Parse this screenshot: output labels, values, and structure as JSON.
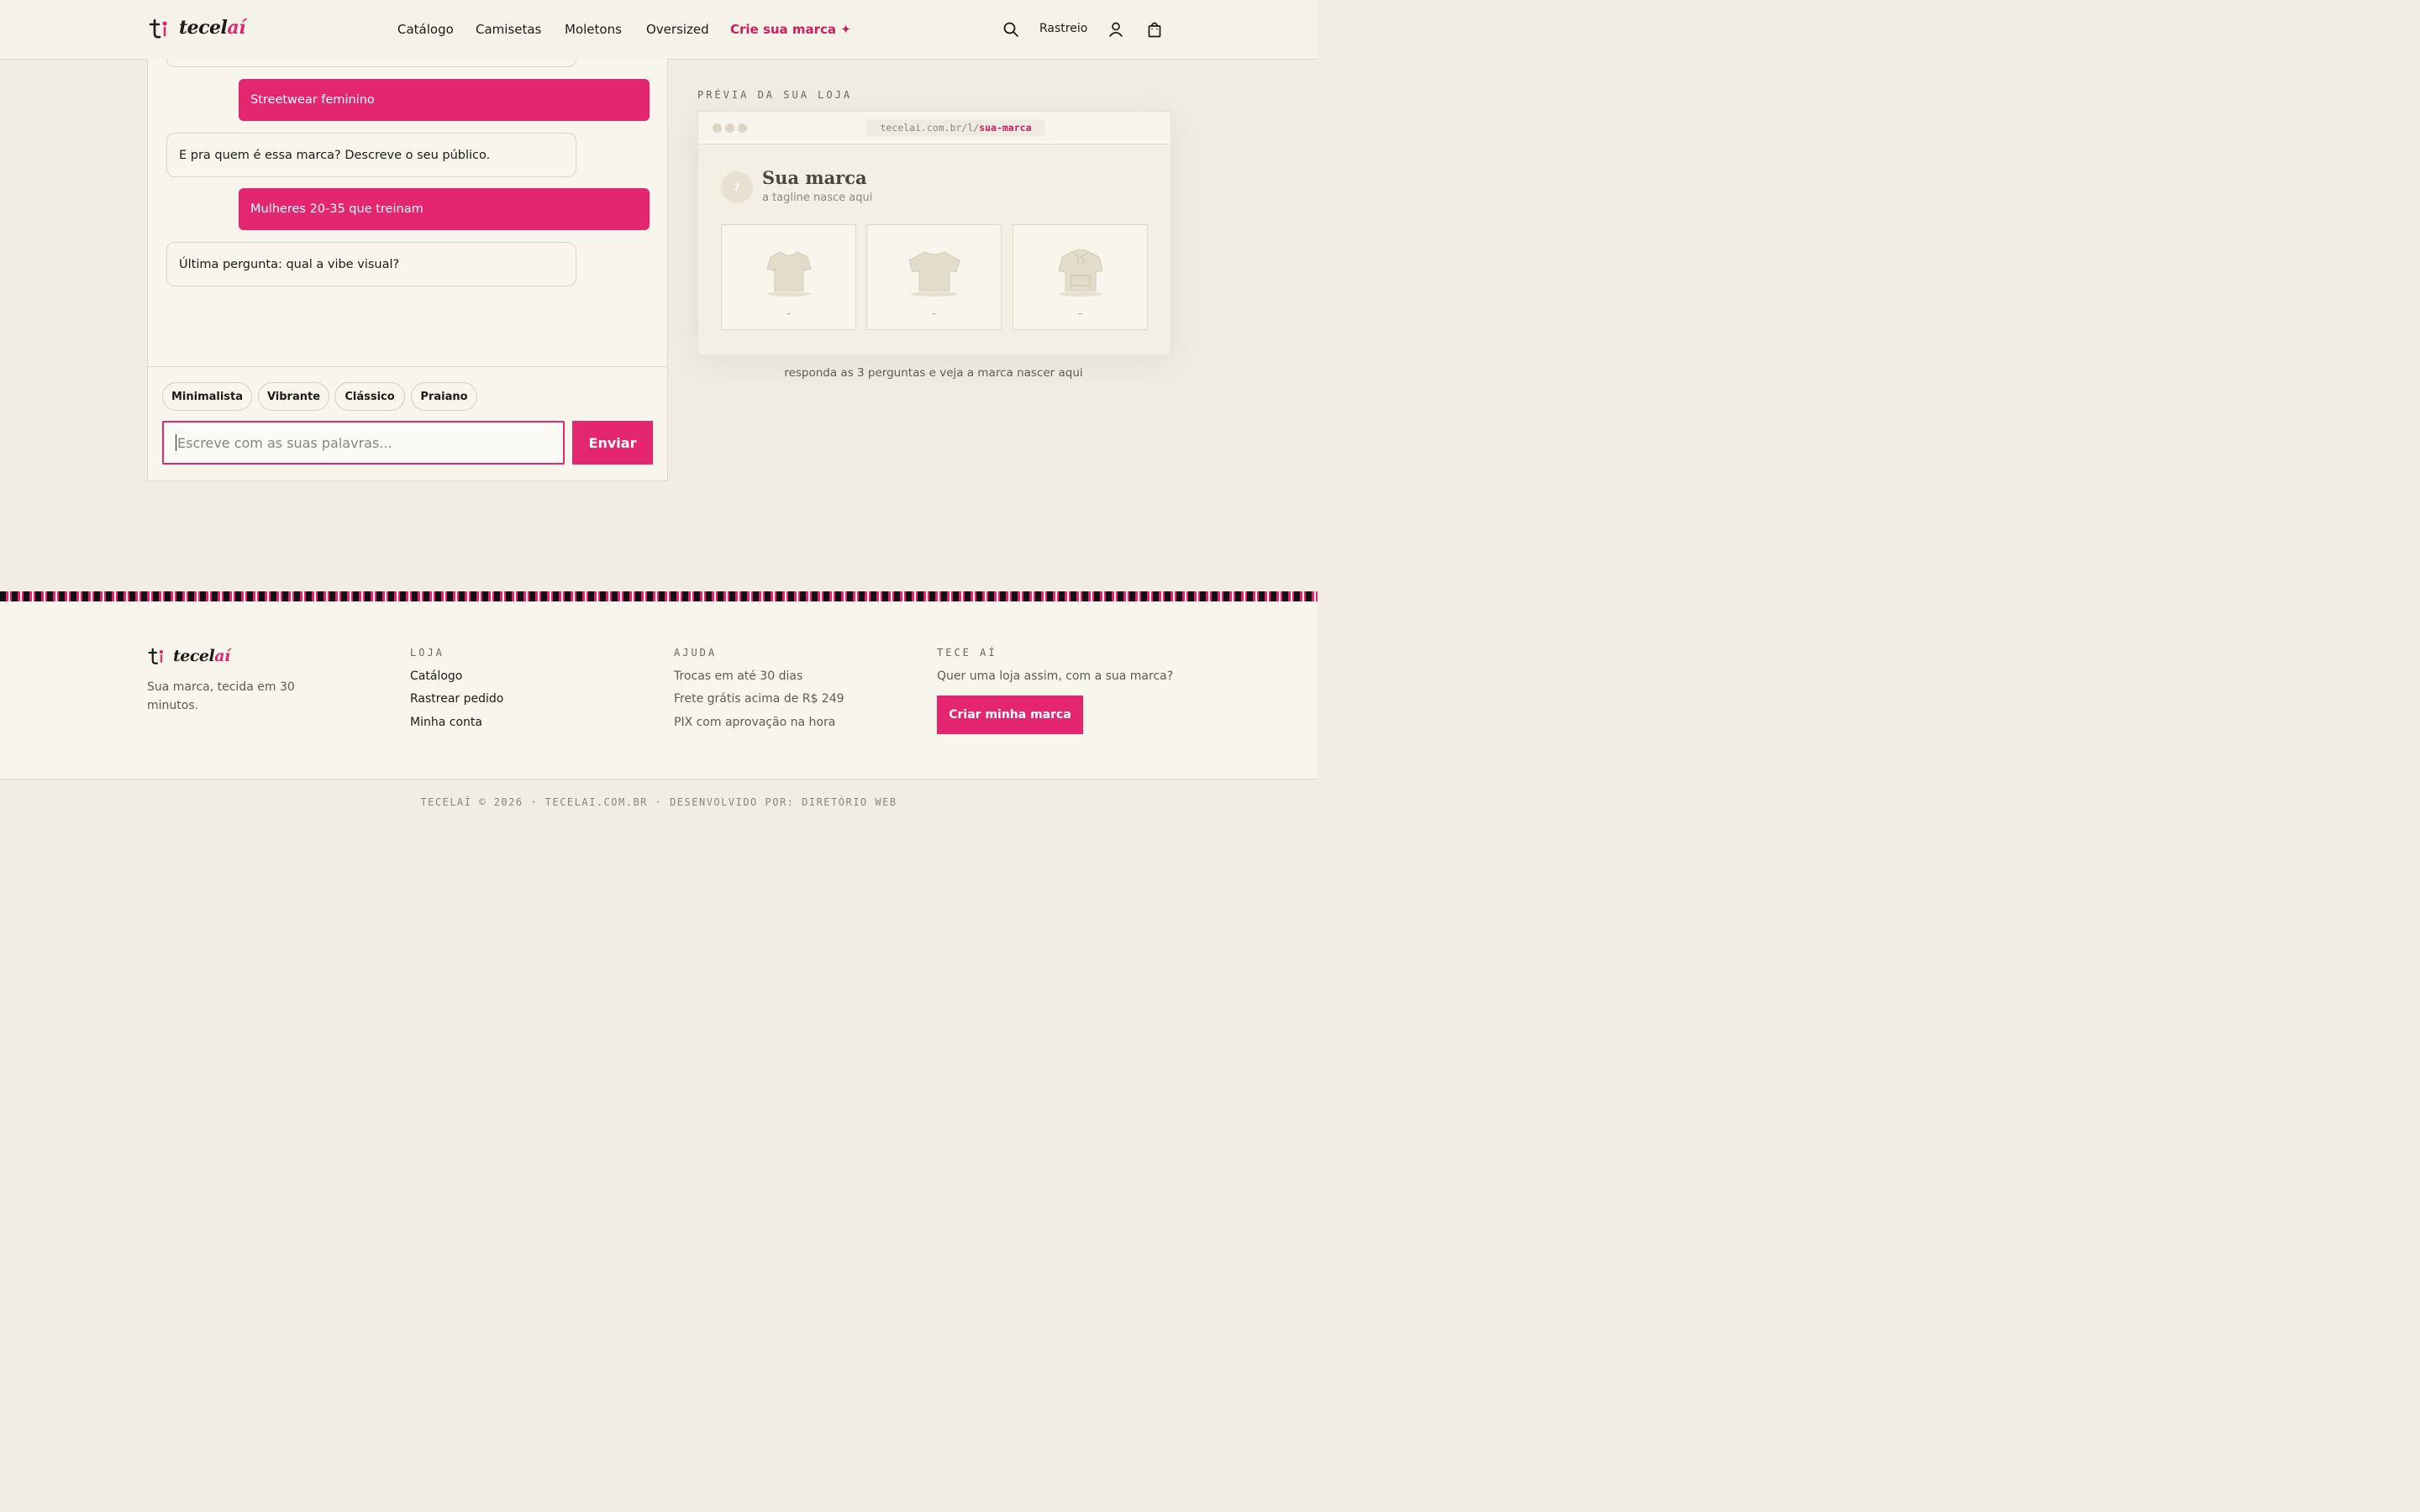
{
  "header": {
    "logo_text_a": "tecel",
    "logo_text_b": "aí",
    "nav": [
      "Catálogo",
      "Camisetas",
      "Moletons",
      "Oversized"
    ],
    "nav_brand": "Crie sua marca ✦",
    "tracking": "Rastreio"
  },
  "chat": {
    "messages": [
      {
        "role": "user",
        "text": "Streetwear feminino"
      },
      {
        "role": "bot",
        "text": "E pra quem é essa marca? Descreve o seu público."
      },
      {
        "role": "user",
        "text": "Mulheres 20-35 que treinam"
      },
      {
        "role": "bot",
        "text": "Última pergunta: qual a vibe visual?"
      }
    ],
    "chips": [
      "Minimalista",
      "Vibrante",
      "Clássico",
      "Praiano"
    ],
    "input_placeholder": "Escreve com as suas palavras...",
    "send_label": "Enviar"
  },
  "preview": {
    "label": "PRÉVIA DA SUA LOJA",
    "url_prefix": "tecelai.com.br/l/",
    "url_slug": "sua-marca",
    "avatar_glyph": "?",
    "brand_name": "Sua marca",
    "tagline": "a tagline nasce aqui",
    "card_labels": [
      "–",
      "–",
      "–"
    ],
    "note": "responda as 3 perguntas e veja a marca nascer aqui"
  },
  "footer": {
    "logo_text_a": "tecel",
    "logo_text_b": "aí",
    "about": "Sua marca, tecida em 30 minutos.",
    "store_heading": "LOJA",
    "store_links": [
      "Catálogo",
      "Rastrear pedido",
      "Minha conta"
    ],
    "help_heading": "AJUDA",
    "help_items": [
      "Trocas em até 30 dias",
      "Frete grátis acima de R$ 249",
      "PIX com aprovação na hora"
    ],
    "cta_heading": "TECE AÍ",
    "cta_text": "Quer uma loja assim, com a sua marca?",
    "cta_button": "Criar minha marca",
    "copyright": "TECELAÍ © 2026 · TECELAI.COM.BR · DESENVOLVIDO POR: DIRETÓRIO WEB"
  },
  "colors": {
    "accent": "#e3266f",
    "background": "#f1ede4",
    "panel": "#f8f5ec"
  }
}
